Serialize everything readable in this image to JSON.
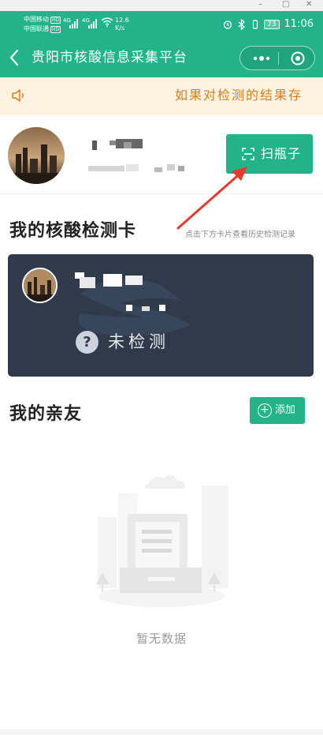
{
  "window_controls": {
    "minimize": "–",
    "maximize": "□",
    "close": "✕"
  },
  "status_bar": {
    "carrier1": "中国移动",
    "carrier2": "中国联通",
    "hd_badge": "HD",
    "network1": "4G",
    "network2": "4G",
    "speed_value": "12.6",
    "speed_unit": "K/s",
    "battery": "73",
    "time": "11:06"
  },
  "navbar": {
    "title": "贵阳市核酸信息采集平台",
    "icons": {
      "back": "chevron-left-icon",
      "more": "more-dots-icon",
      "close": "target-circle-icon"
    }
  },
  "notice": {
    "text": "如果对检测的结果存"
  },
  "profile": {
    "scan_button_label": "扫瓶子",
    "scan_icon": "scan-icon"
  },
  "test_card": {
    "section_title": "我的核酸检测卡",
    "hint": "点击下方卡片查看历史检测记录",
    "status_icon": "?",
    "status_text": "未检测"
  },
  "relatives": {
    "section_title": "我的亲友",
    "add_button_icon": "+",
    "add_button_label": "添加",
    "empty_text": "暂无数据"
  },
  "colors": {
    "brand_green": "#22b488",
    "notice_bg": "#fdf3e0",
    "notice_text": "#e07c1c",
    "card_bg": "#2f3b4b",
    "arrow_red": "#e8392f"
  }
}
